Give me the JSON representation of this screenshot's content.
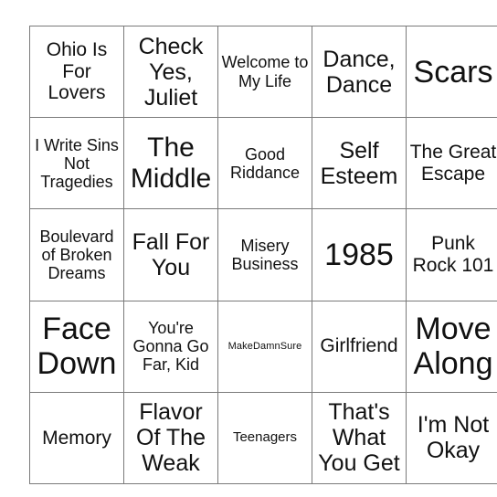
{
  "card": {
    "type": "bingo-card",
    "rows": 5,
    "columns": 5,
    "border_color": "#7a7a7a",
    "text_color": "#111111",
    "background_color": "#ffffff",
    "cells": [
      [
        {
          "text": "Ohio Is For Lovers",
          "size": "lg"
        },
        {
          "text": "Check Yes, Juliet",
          "size": "xl"
        },
        {
          "text": "Welcome to My Life",
          "size": "md"
        },
        {
          "text": "Dance, Dance",
          "size": "xl"
        },
        {
          "text": "Scars",
          "size": "xxxl"
        }
      ],
      [
        {
          "text": "I Write Sins Not Tragedies",
          "size": "md"
        },
        {
          "text": "The Middle",
          "size": "xxl"
        },
        {
          "text": "Good Riddance",
          "size": "md"
        },
        {
          "text": "Self Esteem",
          "size": "xl"
        },
        {
          "text": "The Great Escape",
          "size": "lg"
        }
      ],
      [
        {
          "text": "Boulevard of Broken Dreams",
          "size": "md"
        },
        {
          "text": "Fall For You",
          "size": "xl"
        },
        {
          "text": "Misery Business",
          "size": "md"
        },
        {
          "text": "1985",
          "size": "xxxl"
        },
        {
          "text": "Punk Rock 101",
          "size": "lg"
        }
      ],
      [
        {
          "text": "Face Down",
          "size": "xxxl"
        },
        {
          "text": "You're Gonna Go Far, Kid",
          "size": "md"
        },
        {
          "text": "MakeDamnSure",
          "size": "xs"
        },
        {
          "text": "Girlfriend",
          "size": "lg"
        },
        {
          "text": "Move Along",
          "size": "xxxl"
        }
      ],
      [
        {
          "text": "Memory",
          "size": "lg"
        },
        {
          "text": "Flavor Of The Weak",
          "size": "xl"
        },
        {
          "text": "Teenagers",
          "size": "sm"
        },
        {
          "text": "That's What You Get",
          "size": "xl"
        },
        {
          "text": "I'm Not Okay",
          "size": "xl"
        }
      ]
    ]
  }
}
